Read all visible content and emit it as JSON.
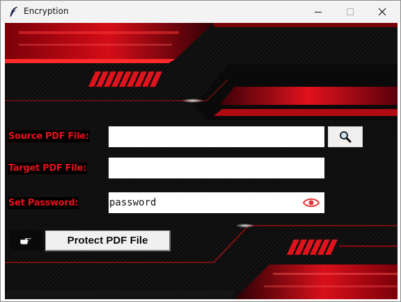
{
  "window": {
    "title": "Encryption",
    "icon": "feather-icon",
    "controls": [
      "minimize-icon",
      "maximize-icon",
      "close-icon"
    ]
  },
  "form": {
    "source_label": "Source PDF File:",
    "source_value": "",
    "target_label": "Target PDF File:",
    "target_value": "",
    "password_label": "Set Password:",
    "password_value": "password",
    "browse_icon": "magnifier-icon",
    "show_password_icon": "eye-icon",
    "pointer_icon": "hand-pointer-icon",
    "protect_label": "Protect PDF File"
  },
  "colors": {
    "label": "#e4111b",
    "accent_red": "#d10f17",
    "background": "#050505",
    "eye": "#e53935"
  }
}
